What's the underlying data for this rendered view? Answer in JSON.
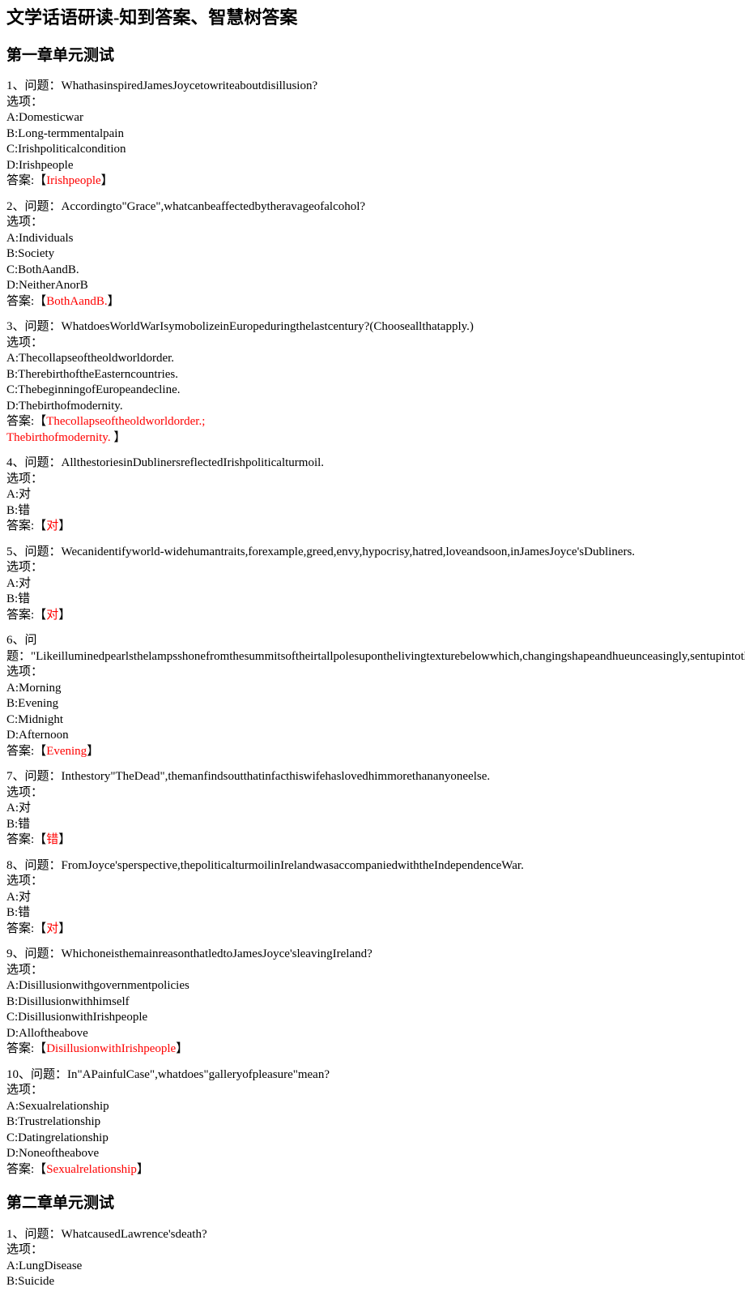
{
  "page_title": "文学话语研读-知到答案、智慧树答案",
  "chapters": [
    {
      "title": "第一章单元测试",
      "questions": [
        {
          "num": "1",
          "qlabel": "问题：",
          "qtext": "WhathasinspiredJamesJoycetowriteaboutdisillusion?",
          "opt_label": "选项：",
          "options": [
            "A:Domesticwar",
            "B:Long-termmentalpain",
            "C:Irishpoliticalcondition",
            "D:Irishpeople"
          ],
          "ans_label": "答案:",
          "ans_open": "【",
          "ans_text": "Irishpeople",
          "ans_close": "】"
        },
        {
          "num": "2",
          "qlabel": "问题：",
          "qtext": "Accordingto\"Grace\",whatcanbeaffectedbytheravageofalcohol?",
          "opt_label": "选项：",
          "options": [
            "A:Individuals",
            "B:Society",
            "C:BothAandB.",
            "D:NeitherAnorB"
          ],
          "ans_label": "答案:",
          "ans_open": "【",
          "ans_text": "BothAandB.",
          "ans_close": "】"
        },
        {
          "num": "3",
          "qlabel": "问题：",
          "qtext": "WhatdoesWorldWarIsymobolizeinEuropeduringthelastcentury?(Chooseallthatapply.)",
          "opt_label": "选项：",
          "options": [
            "A:Thecollapseoftheoldworldorder.",
            "B:TherebirthoftheEasterncountries.",
            "C:ThebeginningofEuropeandecline.",
            "D:Thebirthofmodernity."
          ],
          "ans_label": "答案:",
          "ans_open": "【",
          "ans_text_multi": [
            "Thecollapseoftheoldworldorder.;",
            "Thebirthofmodernity. "
          ],
          "ans_close": "】"
        },
        {
          "num": "4",
          "qlabel": "问题：",
          "qtext": "AllthestoriesinDublinersreflectedIrishpoliticalturmoil.",
          "opt_label": "选项：",
          "options": [
            "A:对",
            "B:错"
          ],
          "ans_label": "答案:",
          "ans_open": "【",
          "ans_text": "对",
          "ans_close": "】"
        },
        {
          "num": "5",
          "qlabel": "问题：",
          "qtext": "Wecanidentifyworld-widehumantraits,forexample,greed,envy,hypocrisy,hatred,loveandsoon,inJamesJoyce'sDubliners.",
          "opt_label": "选项：",
          "options": [
            "A:对",
            "B:错"
          ],
          "ans_label": "答案:",
          "ans_open": "【",
          "ans_text": "对",
          "ans_close": "】"
        },
        {
          "num": "6",
          "qlabel_break": true,
          "qlabel_a": "问",
          "qlabel_b": "题：",
          "qtext": "\"Likeilluminedpearlsthelampsshonefromthesummitsoftheirtallpolesuponthelivingtexturebelowwhich,changingshapeandhueunceasingly,sentupintothewarmgreyeveningairanunchan",
          "opt_label": "选项：",
          "options": [
            "A:Morning",
            "B:Evening",
            "C:Midnight",
            "D:Afternoon"
          ],
          "ans_label": "答案:",
          "ans_open": "【",
          "ans_text": "Evening",
          "ans_close": "】"
        },
        {
          "num": "7",
          "qlabel": "问题：",
          "qtext": "Inthestory\"TheDead\",themanfindsoutthatinfacthiswifehaslovedhimmorethananyoneelse.",
          "opt_label": "选项：",
          "options": [
            "A:对",
            "B:错"
          ],
          "ans_label": "答案:",
          "ans_open": "【",
          "ans_text": "错",
          "ans_close": "】"
        },
        {
          "num": "8",
          "qlabel": "问题：",
          "qtext": "FromJoyce'sperspective,thepoliticalturmoilinIrelandwasaccompaniedwiththeIndependenceWar.",
          "opt_label": "选项：",
          "options": [
            "A:对",
            "B:错"
          ],
          "ans_label": "答案:",
          "ans_open": "【",
          "ans_text": "对",
          "ans_close": "】"
        },
        {
          "num": "9",
          "qlabel": "问题：",
          "qtext": "WhichoneisthemainreasonthatledtoJamesJoyce'sleavingIreland?",
          "opt_label": "选项：",
          "options": [
            "A:Disillusionwithgovernmentpolicies",
            "B:Disillusionwithhimself",
            "C:DisillusionwithIrishpeople",
            "D:Alloftheabove"
          ],
          "ans_label": "答案:",
          "ans_open": "【",
          "ans_text": "DisillusionwithIrishpeople",
          "ans_close": "】"
        },
        {
          "num": "10",
          "qlabel": "问题：",
          "qtext": "In\"APainfulCase\",whatdoes\"galleryofpleasure\"mean?",
          "opt_label": "选项：",
          "options": [
            "A:Sexualrelationship",
            "B:Trustrelationship",
            "C:Datingrelationship",
            "D:Noneoftheabove"
          ],
          "ans_label": "答案:",
          "ans_open": "【",
          "ans_text": "Sexualrelationship",
          "ans_close": "】"
        }
      ]
    },
    {
      "title": "第二章单元测试",
      "questions": [
        {
          "num": "1",
          "qlabel": "问题：",
          "qtext": "WhatcausedLawrence'sdeath?",
          "opt_label": "选项：",
          "options": [
            "A:LungDisease",
            "B:Suicide"
          ],
          "partial": true
        }
      ]
    }
  ]
}
